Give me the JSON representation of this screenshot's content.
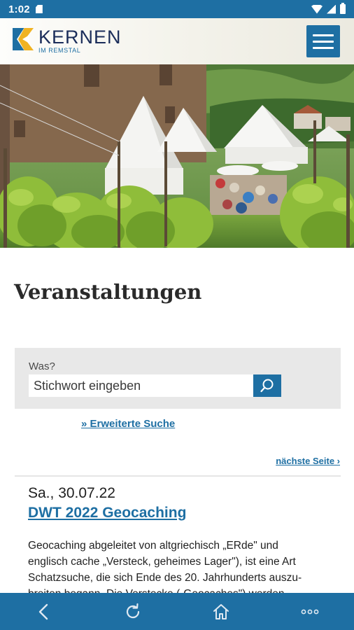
{
  "status_bar": {
    "time": "1:02"
  },
  "header": {
    "logo_title": "KERNEN",
    "logo_subtitle": "IM REMSTAL"
  },
  "page": {
    "title": "Veranstaltungen"
  },
  "search": {
    "label": "Was?",
    "placeholder": "Stichwort eingeben",
    "advanced_link": "» Erweiterte Suche"
  },
  "pagination": {
    "next_label": "nächste Seite ›"
  },
  "events": [
    {
      "date": "Sa., 30.07.22",
      "title": "DWT 2022 Geocaching",
      "description": "Geocaching abgeleitet von altgriechisch „ERde\" und\nenglisch cache „Versteck, geheimes Lager\"), ist eine Art\nSchatzsuche, die sich Ende des 20. Jahrhunderts auszu-\nbreiten begann. Die Verstecke („Geocaches\") werden"
    }
  ],
  "bottom_nav": [
    "back-icon",
    "reload-icon",
    "home-icon",
    "more-icon"
  ],
  "colors": {
    "brand_blue": "#1e6fa3",
    "logo_navy": "#1b2d5a",
    "logo_yellow": "#f0b323"
  }
}
